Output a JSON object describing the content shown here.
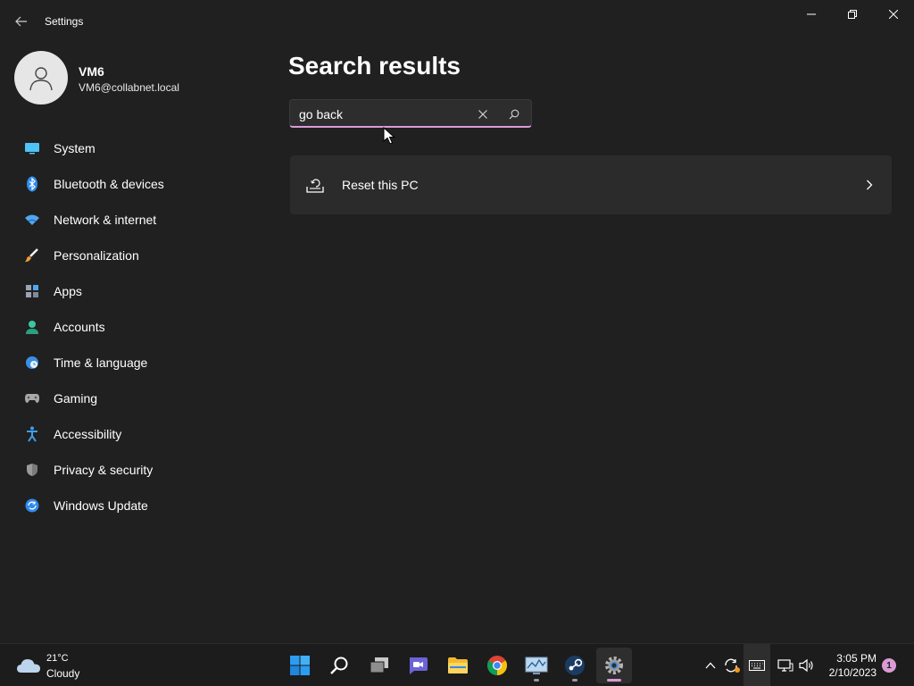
{
  "window": {
    "title": "Settings"
  },
  "profile": {
    "name": "VM6",
    "email": "VM6@collabnet.local"
  },
  "nav": [
    {
      "label": "System",
      "icon": "system-icon"
    },
    {
      "label": "Bluetooth & devices",
      "icon": "bluetooth-icon"
    },
    {
      "label": "Network & internet",
      "icon": "wifi-icon"
    },
    {
      "label": "Personalization",
      "icon": "brush-icon"
    },
    {
      "label": "Apps",
      "icon": "apps-icon"
    },
    {
      "label": "Accounts",
      "icon": "accounts-icon"
    },
    {
      "label": "Time & language",
      "icon": "clock-globe-icon"
    },
    {
      "label": "Gaming",
      "icon": "gamepad-icon"
    },
    {
      "label": "Accessibility",
      "icon": "accessibility-icon"
    },
    {
      "label": "Privacy & security",
      "icon": "shield-icon"
    },
    {
      "label": "Windows Update",
      "icon": "update-icon"
    }
  ],
  "main": {
    "title": "Search results",
    "search": {
      "value": "go back",
      "placeholder": ""
    },
    "results": [
      {
        "label": "Reset this PC",
        "icon": "reset-pc-icon"
      }
    ]
  },
  "taskbar": {
    "weather": {
      "temp": "21°C",
      "condition": "Cloudy"
    },
    "apps": [
      "start-icon",
      "search-icon",
      "task-view-icon",
      "teams-chat-icon",
      "file-explorer-icon",
      "chrome-icon",
      "resource-monitor-icon",
      "steam-icon",
      "settings-icon"
    ],
    "clock": {
      "time": "3:05 PM",
      "date": "2/10/2023"
    },
    "notifications": "1"
  },
  "colors": {
    "accent": "#d99bd6",
    "background": "#202020",
    "card": "#2b2b2b"
  }
}
